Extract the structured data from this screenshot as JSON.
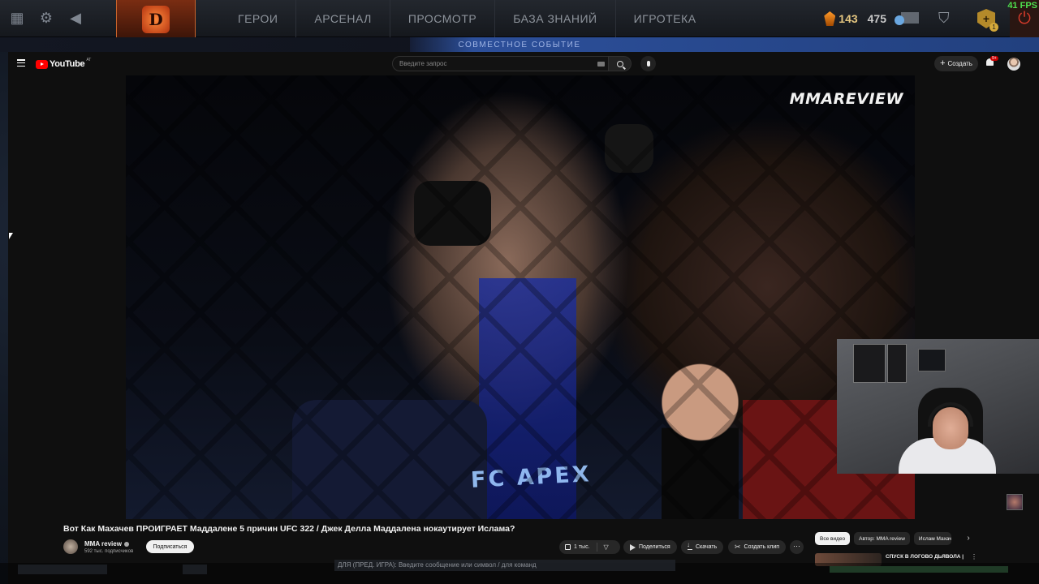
{
  "dota": {
    "nav": [
      "ГЕРОИ",
      "АРСЕНАЛ",
      "ПРОСМОТР",
      "БАЗА ЗНАНИЙ",
      "ИГРОТЕКА"
    ],
    "shards": "143",
    "coins_second": "475",
    "plus_badge": "1",
    "fps": "41 FPS",
    "event_banner": "СОВМЕСТНОЕ СОБЫТИЕ",
    "chat_placeholder": "ДЛЯ (ПРЕД. ИГРА): Введите сообщение или символ / для команд"
  },
  "youtube": {
    "logo_text": "YouTube",
    "country_code": "AT",
    "search_placeholder": "Введите запрос",
    "create_label": "Создать",
    "notification_count": "9+",
    "video": {
      "watermark": "MMAREVIEW",
      "arena_text": "FC APEX",
      "title": "Вот Как Махачев ПРОИГРАЕТ Маддалене 5 причин UFC 322 / Джек Делла Маддалена нокаутирует Ислама?",
      "channel": "MMA review",
      "subscribers": "592 тыс. подписчиков",
      "subscribe_label": "Подписаться",
      "likes": "1 тыс.",
      "share_label": "Поделиться",
      "download_label": "Скачать",
      "clip_label": "Создать клип"
    },
    "chips": [
      "Все видео",
      "Автор: MMA review",
      "Ислам Махачев"
    ],
    "recommended": {
      "title": "СПУСК В ЛОГОВО ДЬЯВОЛА |"
    }
  },
  "colors": {
    "youtube_red": "#ff0000",
    "fps_green": "#4ee04e",
    "dota_gold": "#e4c680"
  }
}
